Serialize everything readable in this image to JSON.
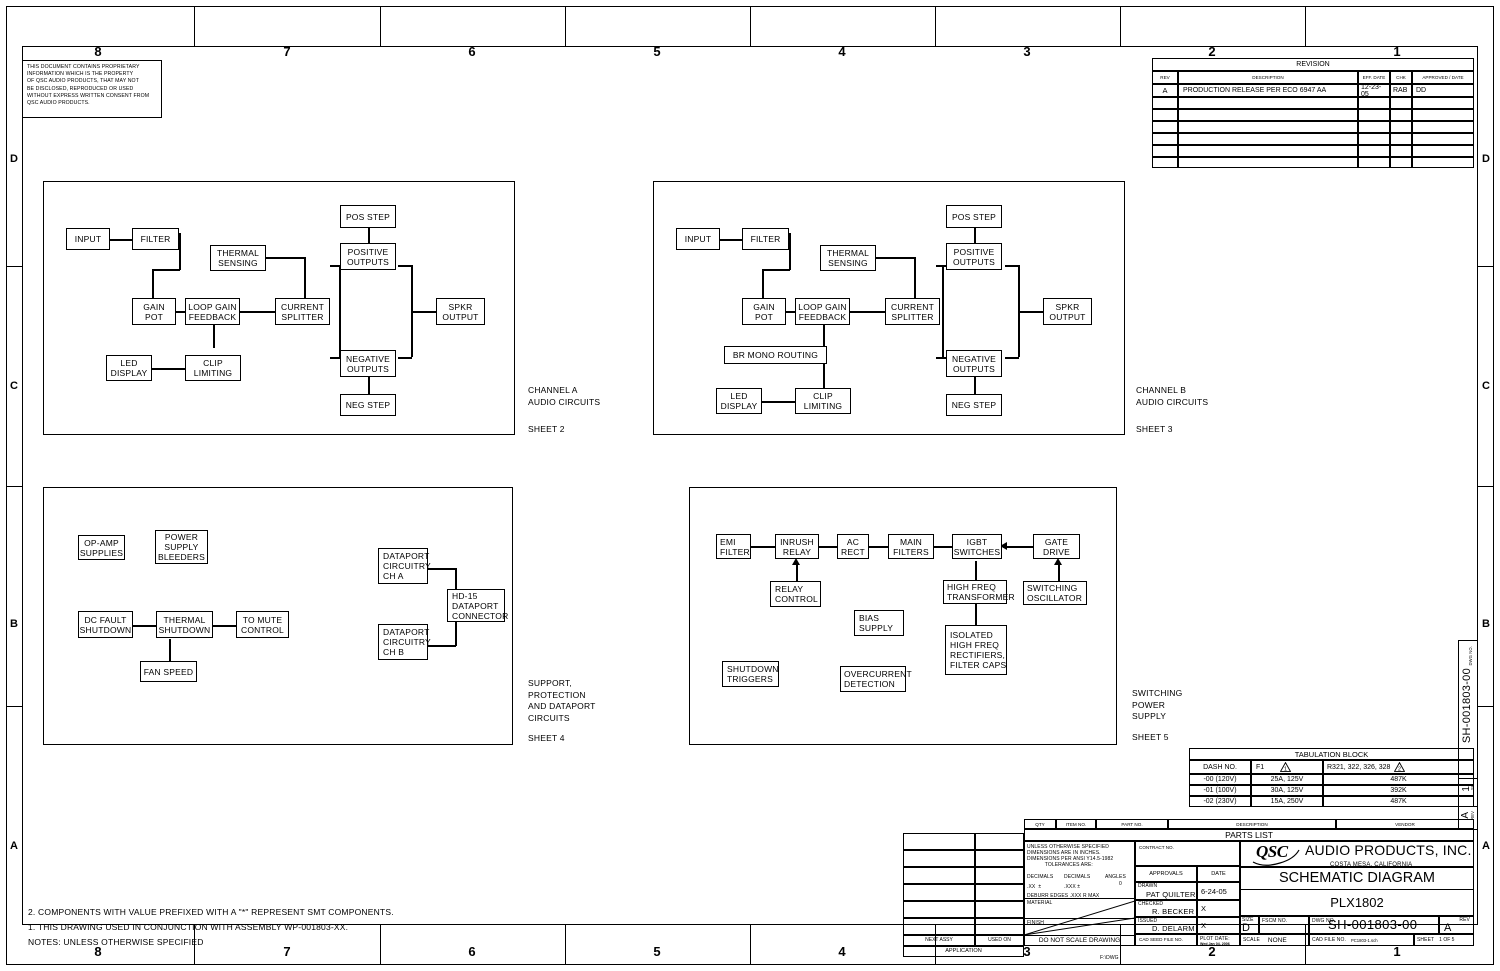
{
  "frame": {
    "zone_columns": [
      "8",
      "7",
      "6",
      "5",
      "4",
      "3",
      "2",
      "1"
    ],
    "zone_rows": [
      "D",
      "C",
      "B",
      "A"
    ]
  },
  "proprietary_notice": "THIS DOCUMENT CONTAINS PROPRIETARY\nINFORMATION WHICH IS THE PROPERTY\nOF QSC AUDIO PRODUCTS, THAT MAY NOT\nBE DISCLOSED, REPRODUCED OR USED\nWITHOUT EXPRESS WRITTEN CONSENT FROM\nQSC AUDIO PRODUCTS.",
  "revision_block": {
    "title": "REVISION",
    "headers": [
      "REV",
      "DESCRIPTION",
      "EFF. DATE",
      "CHK",
      "APPROVED / DATE"
    ],
    "rows": [
      {
        "rev": "A",
        "description": "PRODUCTION RELEASE PER ECO 6947 AA",
        "eff_date": "12-23-05",
        "chk": "RAB",
        "approved": "DD"
      }
    ],
    "blank_rows": 6
  },
  "diagrams": [
    {
      "id": "channel-a",
      "caption": "CHANNEL A\nAUDIO CIRCUITS",
      "sheet": "SHEET 2",
      "blocks": [
        {
          "name": "input",
          "label": "INPUT"
        },
        {
          "name": "filter",
          "label": "FILTER"
        },
        {
          "name": "gain-pot",
          "label": "GAIN\nPOT"
        },
        {
          "name": "loop-gain-feedback",
          "label": "LOOP GAIN\nFEEDBACK"
        },
        {
          "name": "thermal-sensing",
          "label": "THERMAL\nSENSING"
        },
        {
          "name": "current-splitter",
          "label": "CURRENT\nSPLITTER"
        },
        {
          "name": "pos-step",
          "label": "POS STEP"
        },
        {
          "name": "positive-outputs",
          "label": "POSITIVE\nOUTPUTS"
        },
        {
          "name": "negative-outputs",
          "label": "NEGATIVE\nOUTPUTS"
        },
        {
          "name": "neg-step",
          "label": "NEG STEP"
        },
        {
          "name": "spkr-output",
          "label": "SPKR\nOUTPUT"
        },
        {
          "name": "led-display",
          "label": "LED\nDISPLAY"
        },
        {
          "name": "clip-limiting",
          "label": "CLIP\nLIMITING"
        }
      ]
    },
    {
      "id": "channel-b",
      "caption": "CHANNEL B\nAUDIO CIRCUITS",
      "sheet": "SHEET 3",
      "blocks": [
        {
          "name": "input",
          "label": "INPUT"
        },
        {
          "name": "filter",
          "label": "FILTER"
        },
        {
          "name": "gain-pot",
          "label": "GAIN\nPOT"
        },
        {
          "name": "loop-gain-feedback",
          "label": "LOOP GAIN\nFEEDBACK"
        },
        {
          "name": "thermal-sensing",
          "label": "THERMAL\nSENSING"
        },
        {
          "name": "current-splitter",
          "label": "CURRENT\nSPLITTER"
        },
        {
          "name": "pos-step",
          "label": "POS STEP"
        },
        {
          "name": "positive-outputs",
          "label": "POSITIVE\nOUTPUTS"
        },
        {
          "name": "negative-outputs",
          "label": "NEGATIVE\nOUTPUTS"
        },
        {
          "name": "neg-step",
          "label": "NEG STEP"
        },
        {
          "name": "spkr-output",
          "label": "SPKR\nOUTPUT"
        },
        {
          "name": "br-mono-routing",
          "label": "BR MONO ROUTING"
        },
        {
          "name": "led-display",
          "label": "LED\nDISPLAY"
        },
        {
          "name": "clip-limiting",
          "label": "CLIP\nLIMITING"
        }
      ]
    },
    {
      "id": "support-protection",
      "caption": "SUPPORT,\nPROTECTION\nAND DATAPORT\nCIRCUITS",
      "sheet": "SHEET 4",
      "blocks": [
        {
          "name": "op-amp-supplies",
          "label": "OP-AMP\nSUPPLIES"
        },
        {
          "name": "power-supply-bleeders",
          "label": "POWER\nSUPPLY\nBLEEDERS"
        },
        {
          "name": "dc-fault-shutdown",
          "label": "DC FAULT\nSHUTDOWN"
        },
        {
          "name": "thermal-shutdown",
          "label": "THERMAL\nSHUTDOWN"
        },
        {
          "name": "to-mute-control",
          "label": "TO MUTE\nCONTROL"
        },
        {
          "name": "fan-speed",
          "label": "FAN SPEED"
        },
        {
          "name": "dataport-circuitry-ch-a",
          "label": "DATAPORT\nCIRCUITRY\nCH A"
        },
        {
          "name": "dataport-circuitry-ch-b",
          "label": "DATAPORT\nCIRCUITRY\nCH B"
        },
        {
          "name": "hd15-dataport-connector",
          "label": "HD-15\nDATAPORT\nCONNECTOR"
        }
      ]
    },
    {
      "id": "switching-power-supply",
      "caption": "SWITCHING\nPOWER\nSUPPLY",
      "sheet": "SHEET 5",
      "blocks": [
        {
          "name": "emi-filter",
          "label": "EMI\nFILTER"
        },
        {
          "name": "inrush-relay",
          "label": "INRUSH\nRELAY"
        },
        {
          "name": "ac-rect",
          "label": "AC\nRECT"
        },
        {
          "name": "main-filters",
          "label": "MAIN\nFILTERS"
        },
        {
          "name": "igbt-switches",
          "label": "IGBT\nSWITCHES"
        },
        {
          "name": "gate-drive",
          "label": "GATE\nDRIVE"
        },
        {
          "name": "relay-control",
          "label": "RELAY\nCONTROL"
        },
        {
          "name": "high-freq-transformer",
          "label": "HIGH FREQ\nTRANSFORMER"
        },
        {
          "name": "switching-oscillator",
          "label": "SWITCHING\nOSCILLATOR"
        },
        {
          "name": "bias-supply",
          "label": "BIAS\nSUPPLY"
        },
        {
          "name": "isolated-rectifiers",
          "label": "ISOLATED\nHIGH FREQ\nRECTIFIERS,\nFILTER CAPS"
        },
        {
          "name": "shutdown-triggers",
          "label": "SHUTDOWN\nTRIGGERS"
        },
        {
          "name": "overcurrent-detection",
          "label": "OVERCURRENT\nDETECTION"
        }
      ]
    }
  ],
  "tabulation_block": {
    "title": "TABULATION BLOCK",
    "headers": [
      "DASH NO.",
      "F1",
      "R321, 322, 326, 328"
    ],
    "header_flags": [
      "",
      "1",
      "2"
    ],
    "rows": [
      {
        "dash": "-00 (120V)",
        "f1": "25A, 125V",
        "r": "487K"
      },
      {
        "dash": "-01 (100V)",
        "f1": "30A, 125V",
        "r": "392K"
      },
      {
        "dash": "-02 (230V)",
        "f1": "15A, 250V",
        "r": "487K"
      }
    ]
  },
  "parts_list": {
    "title": "PARTS LIST",
    "headers": [
      "QTY",
      "ITEM NO.",
      "PART NO.",
      "DESCRIPTION",
      "VENDOR"
    ]
  },
  "title_block": {
    "unless_specified": "UNLESS OTHERWISE SPECIFIED\nDIMENSIONS ARE IN INCHES.\nDIMENSIONS PER ANSI Y14.5-1982\n            TOLERANCES ARE:",
    "tolerance_headers": [
      "DECIMALS",
      "DECIMALS",
      "ANGLES"
    ],
    "tolerance_values": [
      ".XX  ±",
      ".XXX ±",
      "0"
    ],
    "deburr": "DEBURR EDGES .XXX R MAX",
    "material_label": "MATERIAL",
    "finish_label": "FINISH",
    "do_not_scale": "DO NOT SCALE DRAWING",
    "next_assy_label": "NEXT ASSY",
    "used_on_label": "USED ON",
    "application_label": "APPLICATION",
    "contract_no_label": "CONTRACT NO.",
    "approvals_label": "APPROVALS",
    "date_label": "DATE",
    "approvals": [
      {
        "role": "DRAWN",
        "name": "PAT QUILTER",
        "date": "6-24-05"
      },
      {
        "role": "CHECKED",
        "name": "R. BECKER",
        "date": "X"
      },
      {
        "role": "ISSUED",
        "name": "D. DELARM",
        "date": "X"
      }
    ],
    "cad_seed_label": "CAD SEED FILE NO.",
    "plot_date_label": "PLOT DATE:",
    "plot_date_value": "Wed Jan 04, 2006",
    "company_logo": "QSC",
    "company_name": "AUDIO PRODUCTS, INC.",
    "company_city": "COSTA MESA, CALIFORNIA",
    "doc_type": "SCHEMATIC DIAGRAM",
    "product": "PLX1802",
    "size_label": "SIZE",
    "size_value": "D",
    "fscm_label": "FSCM NO.",
    "fscm_value": "",
    "dwg_no_label": "DWG NO.",
    "dwg_no_value": "SH-001803-00",
    "rev_label": "REV",
    "rev_value": "A",
    "scale_label": "SCALE",
    "scale_value": "NONE",
    "cad_file_label": "CAD FILE NO.",
    "cad_file_value": "PC1803-1.sch",
    "sheet_label": "SHEET",
    "sheet_value": "1  OF  5",
    "footer_path": "F:\\DWG"
  },
  "side_tab": {
    "dwg_no_label": "DWG NO.",
    "dwg_no_value": "SH-001803-00",
    "sh_label": "SH",
    "sh_value": "1",
    "rev_label": "REV",
    "rev_value": "A"
  },
  "notes": {
    "line2": "2. COMPONENTS WITH VALUE PREFIXED WITH A \"*\" REPRESENT SMT COMPONENTS.",
    "line1": "1. THIS DRAWING USED IN CONJUNCTION WITH ASSEMBLY WP-001803-XX.",
    "line0": "NOTES: UNLESS OTHERWISE SPECIFIED"
  }
}
